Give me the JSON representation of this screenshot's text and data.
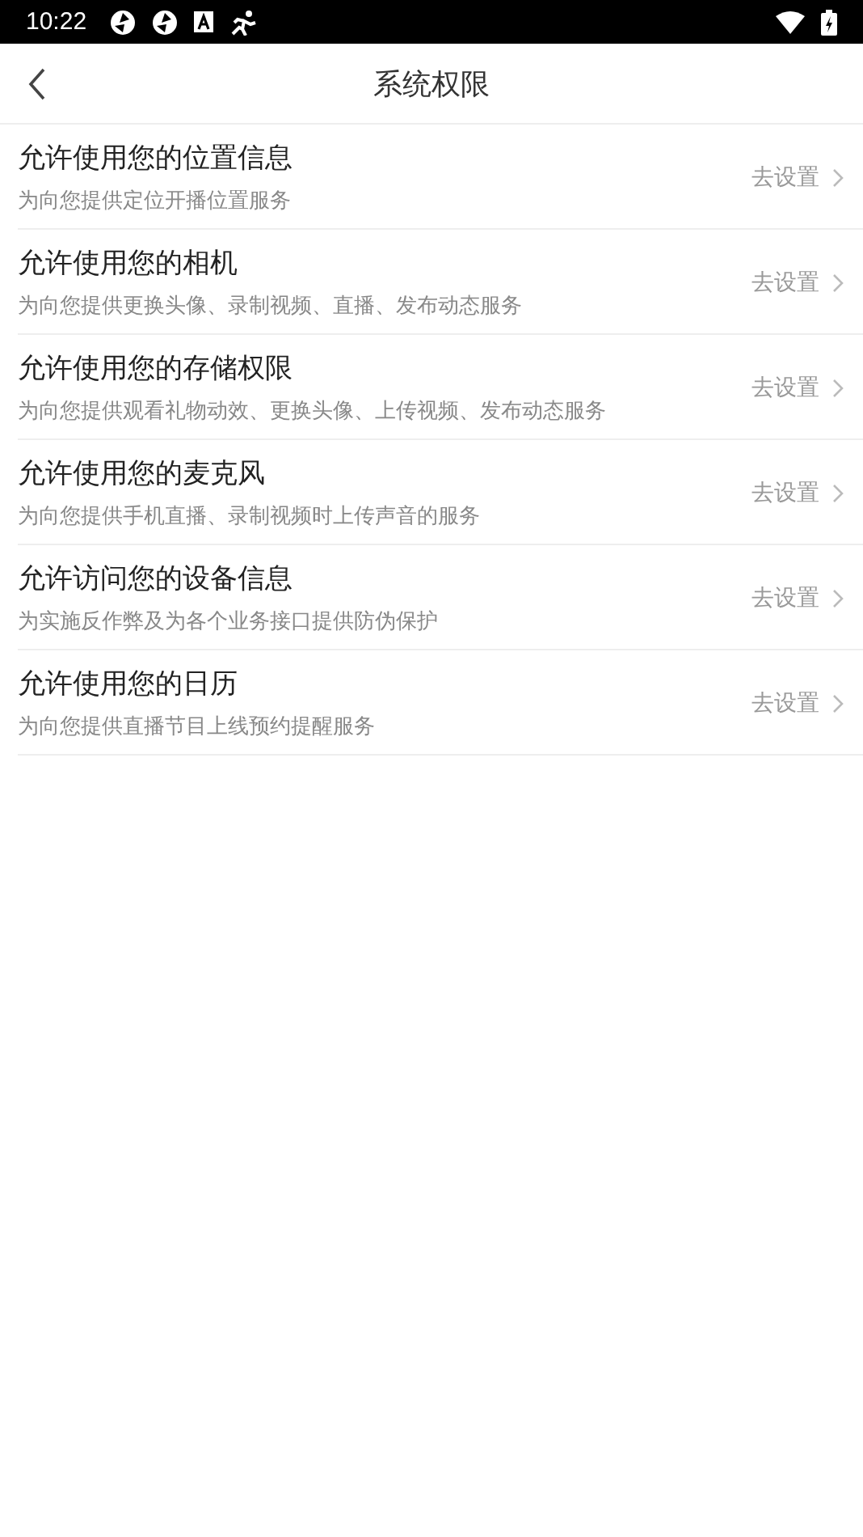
{
  "status_bar": {
    "time": "10:22"
  },
  "header": {
    "title": "系统权限"
  },
  "permissions": [
    {
      "title": "允许使用您的位置信息",
      "description": "为向您提供定位开播位置服务",
      "action": "去设置"
    },
    {
      "title": "允许使用您的相机",
      "description": "为向您提供更换头像、录制视频、直播、发布动态服务",
      "action": "去设置"
    },
    {
      "title": "允许使用您的存储权限",
      "description": "为向您提供观看礼物动效、更换头像、上传视频、发布动态服务",
      "action": "去设置"
    },
    {
      "title": "允许使用您的麦克风",
      "description": "为向您提供手机直播、录制视频时上传声音的服务",
      "action": "去设置"
    },
    {
      "title": "允许访问您的设备信息",
      "description": "为实施反作弊及为各个业务接口提供防伪保护",
      "action": "去设置"
    },
    {
      "title": "允许使用您的日历",
      "description": "为向您提供直播节目上线预约提醒服务",
      "action": "去设置"
    }
  ]
}
